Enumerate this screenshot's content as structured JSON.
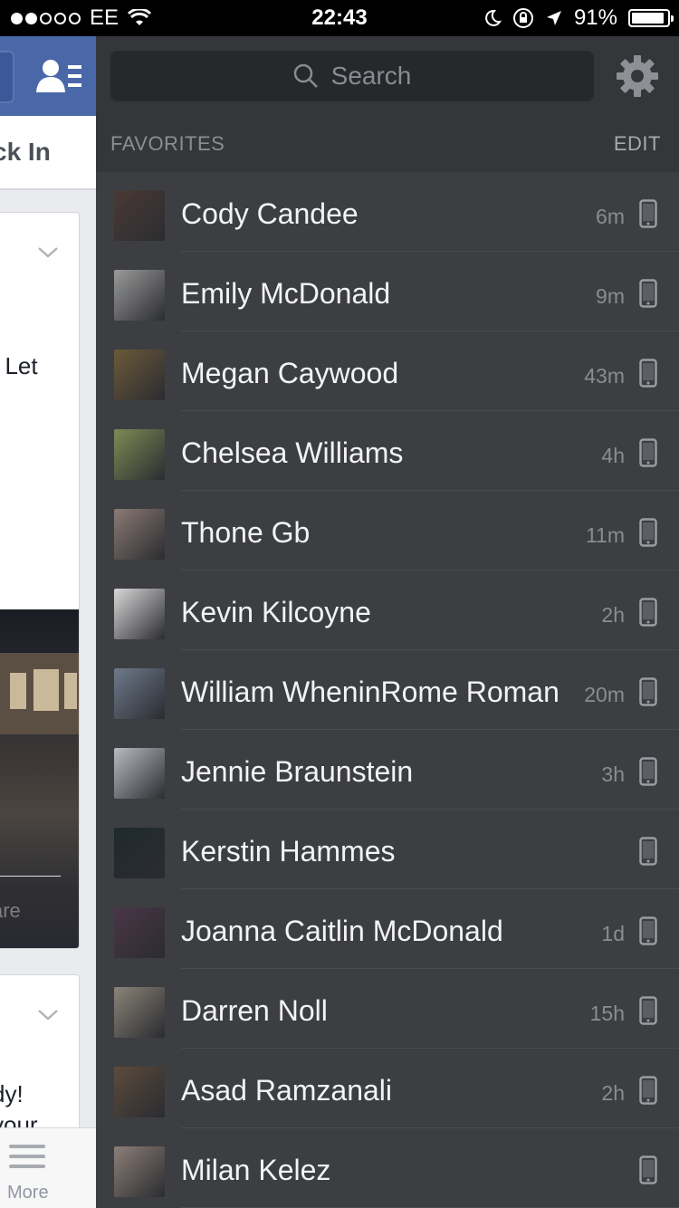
{
  "status_bar": {
    "carrier": "EE",
    "signal_bars": 2,
    "time": "22:43",
    "battery": "91%",
    "battery_level": 0.91
  },
  "feed": {
    "checkin_label": "ck In",
    "snippet_1": ". Let",
    "snippet_share": "are",
    "snippet_2": "dy!",
    "snippet_3": "your",
    "tab_more": "More"
  },
  "chat": {
    "search_placeholder": "Search",
    "favorites_title": "FAVORITES",
    "edit_label": "EDIT",
    "contacts": [
      {
        "name": "Cody Candee",
        "time": "6m",
        "avatar_color": "#4a3a36"
      },
      {
        "name": "Emily McDonald",
        "time": "9m",
        "avatar_color": "#9a9a9a"
      },
      {
        "name": "Megan Caywood",
        "time": "43m",
        "avatar_color": "#6b5a3a"
      },
      {
        "name": "Chelsea Williams",
        "time": "4h",
        "avatar_color": "#7f8a55"
      },
      {
        "name": "Thone Gb",
        "time": "11m",
        "avatar_color": "#8a7a74"
      },
      {
        "name": "Kevin Kilcoyne",
        "time": "2h",
        "avatar_color": "#d8d8d8"
      },
      {
        "name": "William WheninRome Roman",
        "time": "20m",
        "avatar_color": "#6e7a8c"
      },
      {
        "name": "Jennie Braunstein",
        "time": "3h",
        "avatar_color": "#b7bcc2"
      },
      {
        "name": "Kerstin Hammes",
        "time": "",
        "avatar_color": "#1f2a2e"
      },
      {
        "name": "Joanna Caitlin McDonald",
        "time": "1d",
        "avatar_color": "#4a3748"
      },
      {
        "name": "Darren Noll",
        "time": "15h",
        "avatar_color": "#8a8478"
      },
      {
        "name": "Asad Ramzanali",
        "time": "2h",
        "avatar_color": "#5b4b3c"
      },
      {
        "name": "Milan Kelez",
        "time": "",
        "avatar_color": "#8c7f78"
      }
    ]
  }
}
